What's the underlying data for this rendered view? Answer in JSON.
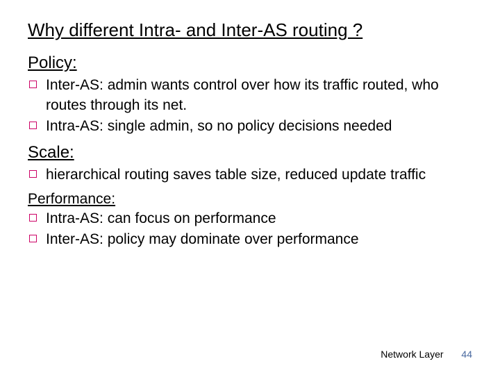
{
  "title": "Why different Intra- and Inter-AS routing ?",
  "sections": {
    "policy": {
      "heading": "Policy:",
      "bullets": [
        "Inter-AS: admin wants control over how its traffic routed, who routes through its net.",
        "Intra-AS: single admin, so no policy decisions needed"
      ]
    },
    "scale": {
      "heading": "Scale:",
      "bullets": [
        "hierarchical routing saves table size, reduced update traffic"
      ]
    },
    "performance": {
      "heading": "Performance:",
      "bullets": [
        "Intra-AS: can focus on performance",
        "Inter-AS: policy may dominate over performance"
      ]
    }
  },
  "footer": {
    "label": "Network Layer",
    "page": "44"
  }
}
